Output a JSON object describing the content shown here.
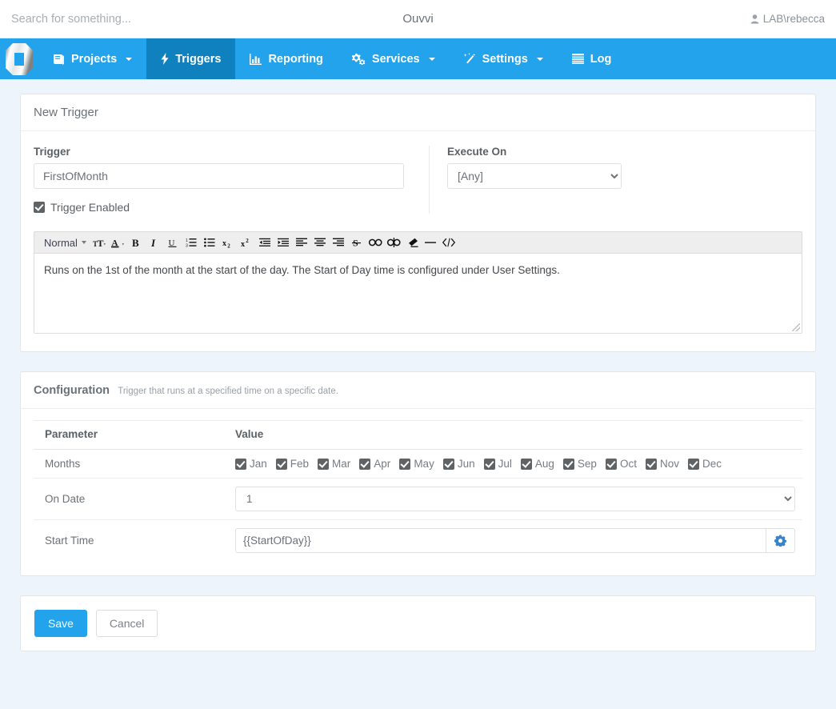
{
  "topbar": {
    "search_placeholder": "Search for something...",
    "search_value": "",
    "app_title": "Ouvvi",
    "user_name": "LAB\\rebecca",
    "user_icon": "user-icon"
  },
  "nav": {
    "logo_icon": "ouvvi-logo-icon",
    "items": [
      {
        "label": "Projects",
        "icon": "book-icon",
        "caret": true,
        "active": false
      },
      {
        "label": "Triggers",
        "icon": "bolt-icon",
        "caret": false,
        "active": true
      },
      {
        "label": "Reporting",
        "icon": "bar-chart-icon",
        "caret": false,
        "active": false
      },
      {
        "label": "Services",
        "icon": "cogs-icon",
        "caret": true,
        "active": false
      },
      {
        "label": "Settings",
        "icon": "magic-wand-icon",
        "caret": true,
        "active": false
      },
      {
        "label": "Log",
        "icon": "list-icon",
        "caret": false,
        "active": false
      }
    ]
  },
  "trigger_panel": {
    "title": "New Trigger",
    "trigger_label": "Trigger",
    "trigger_value": "FirstOfMonth",
    "trigger_placeholder": "",
    "enabled_label": "Trigger Enabled",
    "enabled_checked": true,
    "execute_on_label": "Execute On",
    "execute_on_value": "[Any]",
    "execute_on_options": [
      "[Any]"
    ]
  },
  "editor": {
    "style_label": "Normal",
    "content": "Runs on the 1st of the month at the start of the day. The Start of Day time is configured under User Settings.",
    "toolbar_icons": [
      "font-size-icon",
      "text-color-icon",
      "bold-icon",
      "italic-icon",
      "underline-icon",
      "ordered-list-icon",
      "unordered-list-icon",
      "subscript-icon",
      "superscript-icon",
      "outdent-icon",
      "indent-icon",
      "align-left-icon",
      "align-center-icon",
      "align-right-icon",
      "strikethrough-icon",
      "link-icon",
      "unlink-icon",
      "eraser-icon",
      "horizontal-rule-icon",
      "code-icon"
    ]
  },
  "configuration": {
    "title": "Configuration",
    "subtitle": "Trigger that runs at a specified time on a specific date.",
    "columns": [
      "Parameter",
      "Value"
    ],
    "rows": [
      {
        "parameter": "Months",
        "type": "checkbox-group"
      },
      {
        "parameter": "On Date",
        "type": "select",
        "value": "1"
      },
      {
        "parameter": "Start Time",
        "type": "input-group",
        "value": "{{StartOfDay}}",
        "button_icon": "gear-icon"
      }
    ],
    "months": [
      {
        "label": "Jan",
        "checked": true
      },
      {
        "label": "Feb",
        "checked": true
      },
      {
        "label": "Mar",
        "checked": true
      },
      {
        "label": "Apr",
        "checked": true
      },
      {
        "label": "May",
        "checked": true
      },
      {
        "label": "Jun",
        "checked": true
      },
      {
        "label": "Jul",
        "checked": true
      },
      {
        "label": "Aug",
        "checked": true
      },
      {
        "label": "Sep",
        "checked": true
      },
      {
        "label": "Oct",
        "checked": true
      },
      {
        "label": "Nov",
        "checked": true
      },
      {
        "label": "Dec",
        "checked": true
      }
    ],
    "on_date_options": [
      "1"
    ]
  },
  "actions": {
    "save_label": "Save",
    "cancel_label": "Cancel"
  },
  "colors": {
    "brand_blue": "#22a3eb",
    "active_blue": "#1081bf",
    "page_bg": "#eef4fb",
    "checkbox_fill": "#5f6366"
  }
}
